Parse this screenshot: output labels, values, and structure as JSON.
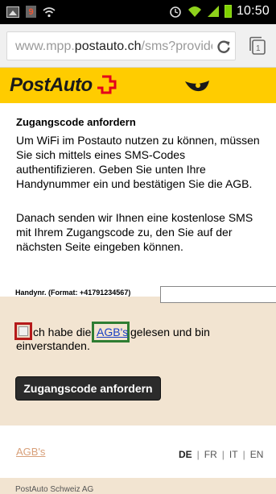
{
  "status_bar": {
    "time": "10:50",
    "badge": "9",
    "icons": [
      "image-icon",
      "badge-icon",
      "wifi-icon",
      "alarm-icon",
      "wifi-signal-icon",
      "cell-signal-icon",
      "battery-icon"
    ]
  },
  "browser": {
    "url_prefix": "www.mpp.",
    "url_domain": "postauto.ch",
    "url_suffix": "/sms?provider=",
    "tabs_count": "1"
  },
  "brand": {
    "logo_text": "PostAuto",
    "brand_color": "#ffcc00"
  },
  "content": {
    "title": "Zugangscode anfordern",
    "paragraph1": "Um WiFi im Postauto nutzen zu können, müssen Sie sich mittels eines SMS-Codes authentifizieren. Geben Sie unten Ihre Handynummer ein und bestätigen Sie die AGB.",
    "paragraph2": "Danach senden wir Ihnen eine kostenlose SMS mit Ihrem Zugangscode zu, den Sie auf der nächsten Seite eingeben können."
  },
  "form": {
    "phone_label": "Handynr. (Format: +41791234567)",
    "phone_value": "",
    "agree_pre": "ch habe die",
    "agree_link": "AGB's",
    "agree_post": "gelesen und bin",
    "agree_line2": "einverstanden.",
    "submit_label": "Zugangscode anfordern"
  },
  "footer": {
    "agb_link": "AGB's",
    "languages": [
      "DE",
      "FR",
      "IT",
      "EN"
    ],
    "active_language": "DE",
    "company": "PostAuto Schweiz AG"
  },
  "colors": {
    "form_background": "#f2e4d1",
    "button": "#2b2b2b",
    "checkbox_highlight": "#b51a1a",
    "link_highlight": "#2e7d32"
  }
}
